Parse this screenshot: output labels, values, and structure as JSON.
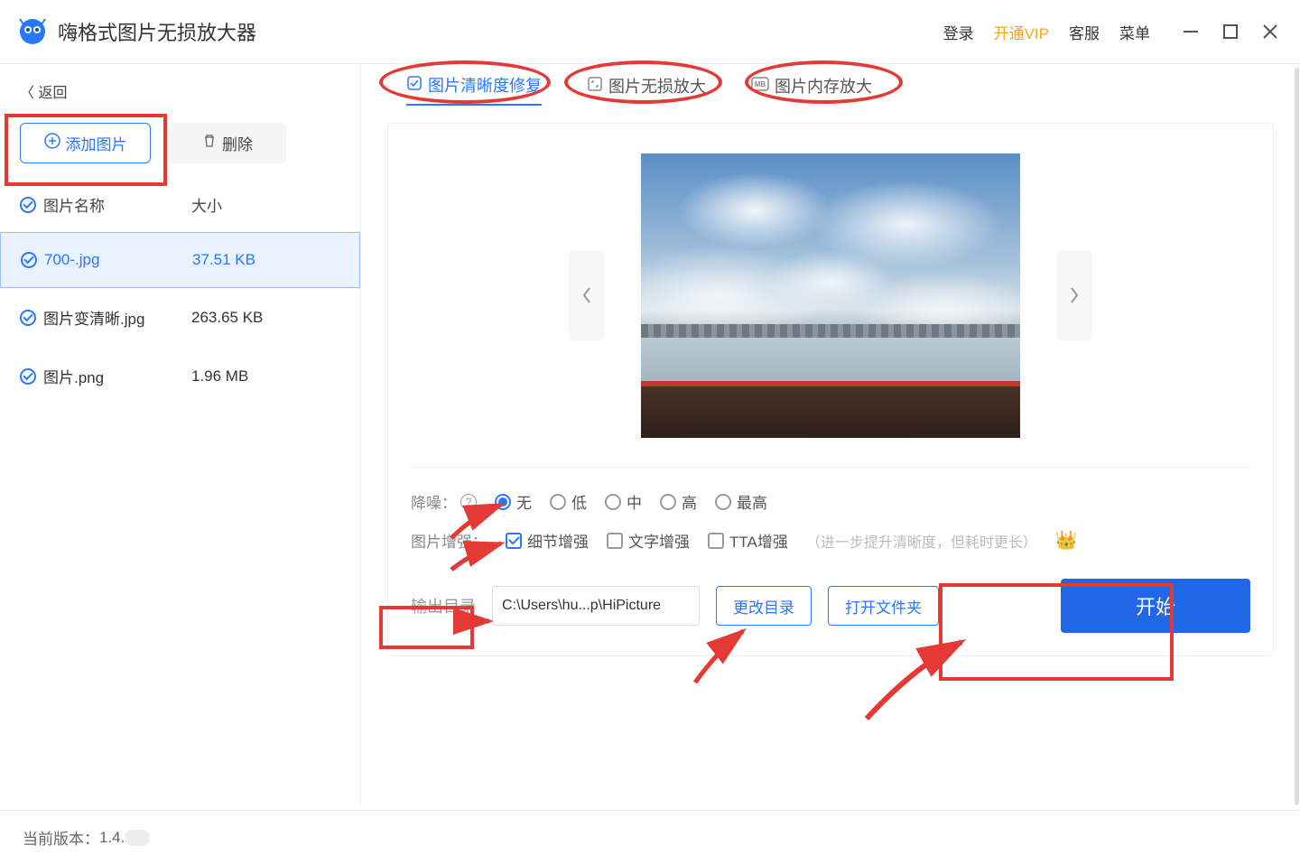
{
  "titlebar": {
    "app_title": "嗨格式图片无损放大器",
    "login": "登录",
    "vip": "开通VIP",
    "support": "客服",
    "menu": "菜单"
  },
  "sidebar": {
    "back": "返回",
    "add_btn": "添加图片",
    "del_btn": "删除",
    "col_name": "图片名称",
    "col_size": "大小",
    "rows": [
      {
        "name": "700-.jpg",
        "size": "37.51 KB",
        "selected": true
      },
      {
        "name": "图片变清晰.jpg",
        "size": "263.65 KB",
        "selected": false
      },
      {
        "name": "图片.png",
        "size": "1.96 MB",
        "selected": false
      }
    ]
  },
  "tabs": {
    "t1": "图片清晰度修复",
    "t2": "图片无损放大",
    "t3": "图片内存放大"
  },
  "options": {
    "noise_label": "降噪：",
    "noise_levels": {
      "none": "无",
      "low": "低",
      "mid": "中",
      "high": "高",
      "max": "最高"
    },
    "noise_selected": "none",
    "enhance_label": "图片增强：",
    "enh_detail": "细节增强",
    "enh_text": "文字增强",
    "enh_tta": "TTA增强",
    "enh_hint": "（进一步提升清晰度，但耗时更长）"
  },
  "output": {
    "label": "输出目录",
    "path": "C:\\Users\\hu...p\\HiPicture",
    "change": "更改目录",
    "open": "打开文件夹",
    "start": "开始"
  },
  "footer": {
    "version_label": "当前版本：",
    "version": "1.4."
  }
}
